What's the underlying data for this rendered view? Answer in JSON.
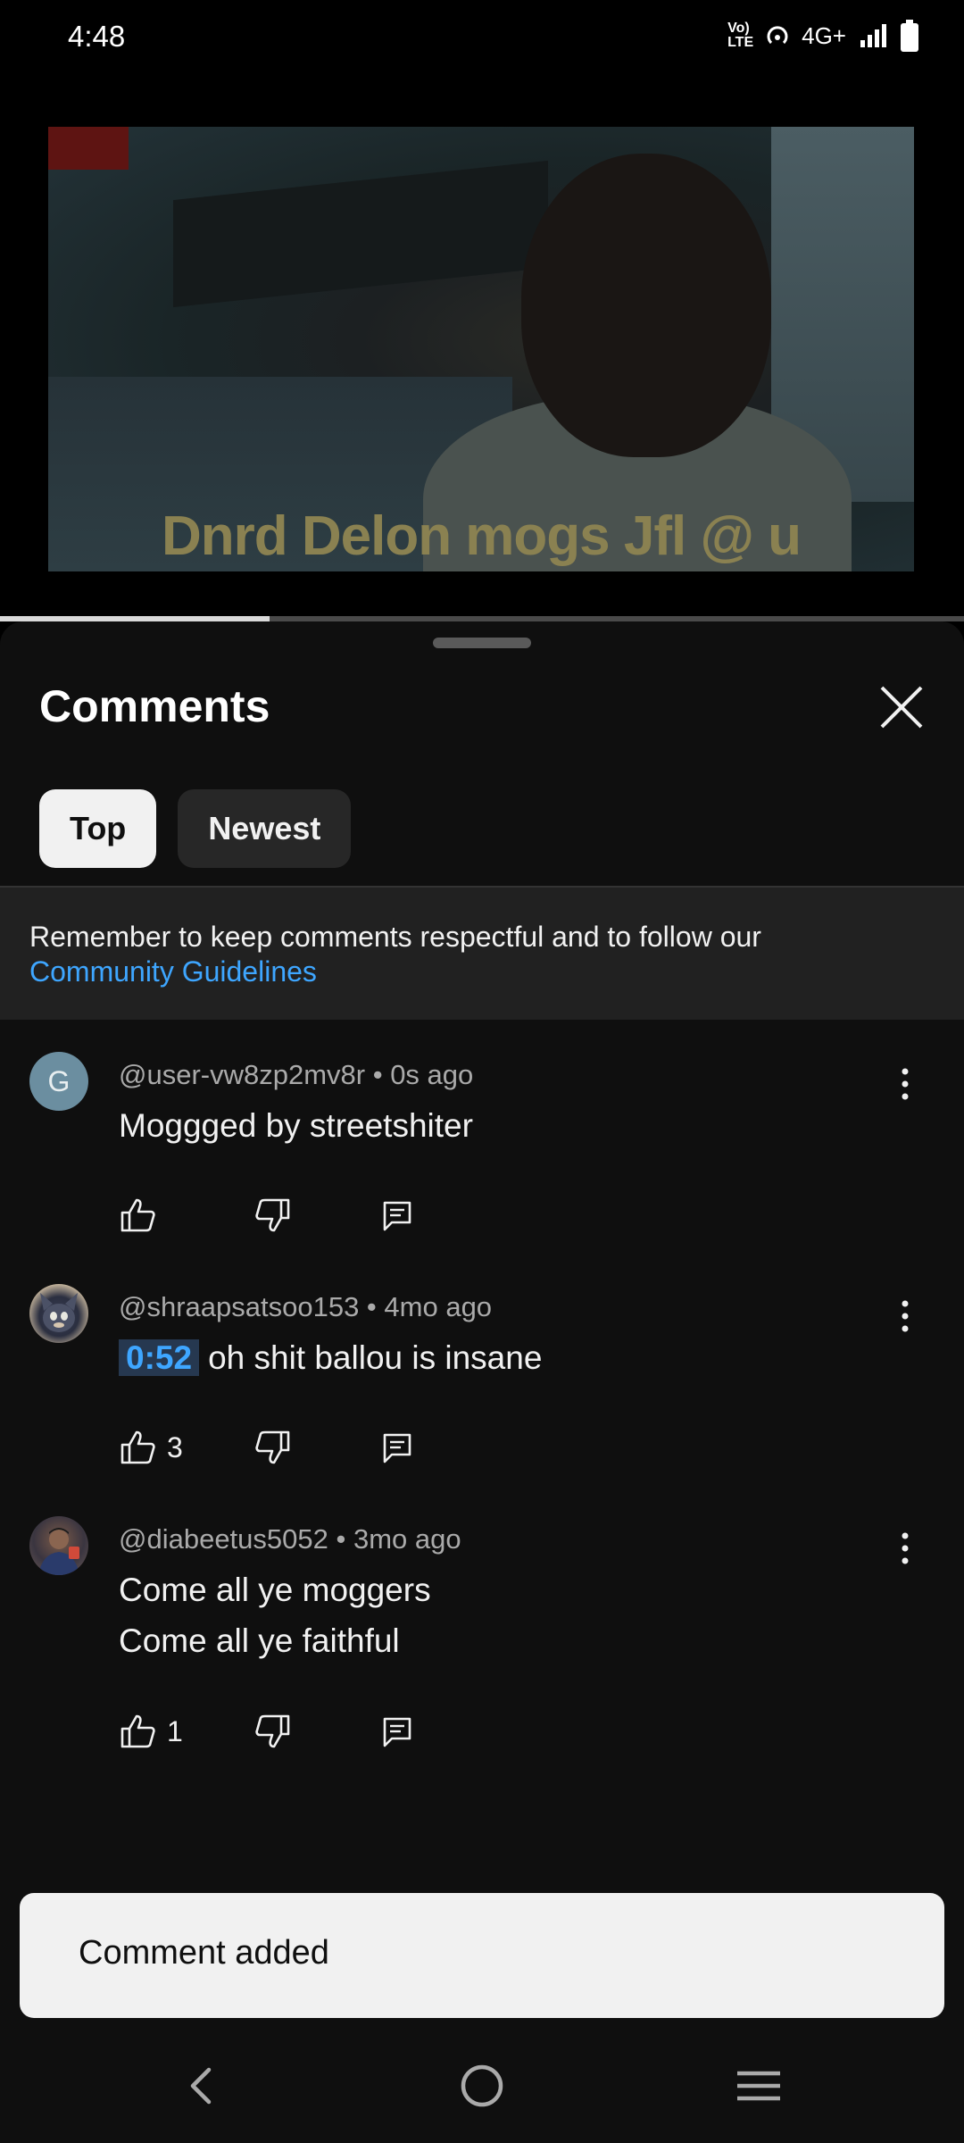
{
  "status_bar": {
    "time": "4:48",
    "network": "4G+",
    "volte": "VoLTE"
  },
  "video": {
    "caption": "Dnrd Delon mogs Jfl @ u",
    "progress": 0.28
  },
  "comments_panel": {
    "title": "Comments",
    "tabs": [
      {
        "label": "Top",
        "active": true
      },
      {
        "label": "Newest",
        "active": false
      }
    ],
    "guidelines": {
      "text": "Remember to keep comments respectful and to follow our",
      "link": "Community Guidelines"
    }
  },
  "comments": [
    {
      "author": "@user-vw8zp2mv8r",
      "age": "0s ago",
      "avatar_letter": "G",
      "timestamp": "",
      "text": "Moggged by streetshiter",
      "likes": ""
    },
    {
      "author": "@shraapsatsoo153",
      "age": "4mo ago",
      "avatar_letter": "",
      "timestamp": "0:52",
      "text": "oh shit ballou is insane",
      "likes": "3"
    },
    {
      "author": "@diabeetus5052",
      "age": "3mo ago",
      "avatar_letter": "",
      "timestamp": "",
      "text_lines": [
        "Come all ye moggers",
        "Come all ye faithful"
      ],
      "likes": "1"
    }
  ],
  "toast": {
    "text": "Comment added"
  },
  "icons": [
    "close-icon",
    "more-vert-icon",
    "thumbs-up-icon",
    "thumbs-down-icon",
    "reply-icon",
    "back-icon",
    "home-icon",
    "recents-icon"
  ],
  "colors": {
    "accent_link": "#3ea6ff",
    "sheet_bg": "#0f0f0f",
    "chip_active": "#f1f1f1"
  }
}
